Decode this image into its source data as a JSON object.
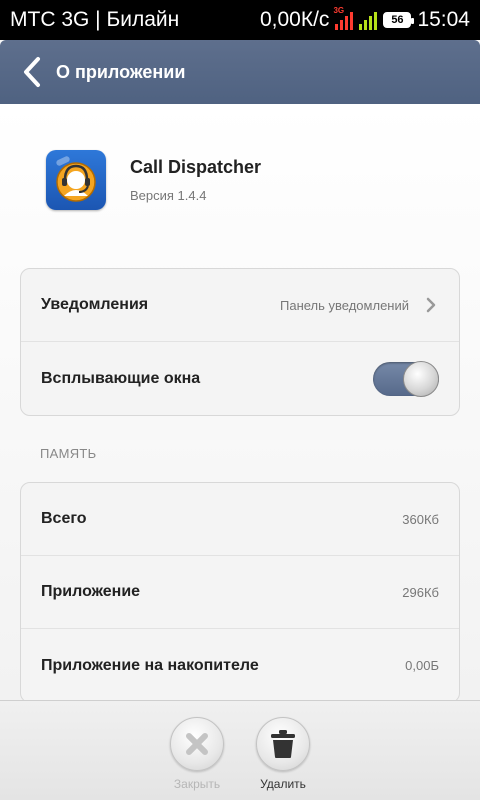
{
  "status_bar": {
    "carrier": "МТС 3G | Билайн",
    "speed": "0,00К/с",
    "net_tag": "3G",
    "battery": "56",
    "time": "15:04"
  },
  "action_bar": {
    "title": "О приложении"
  },
  "app": {
    "name": "Call Dispatcher",
    "version": "Версия 1.4.4"
  },
  "settings": [
    {
      "label": "Уведомления",
      "value": "Панель уведомлений"
    },
    {
      "label": "Всплывающие окна",
      "toggle": true
    }
  ],
  "memory": {
    "header": "ПАМЯТЬ",
    "rows": [
      {
        "label": "Всего",
        "value": "360Кб"
      },
      {
        "label": "Приложение",
        "value": "296Кб"
      },
      {
        "label": "Приложение на накопителе",
        "value": "0,00Б"
      }
    ]
  },
  "bottom": {
    "close_label": "Закрыть",
    "delete_label": "Удалить"
  }
}
